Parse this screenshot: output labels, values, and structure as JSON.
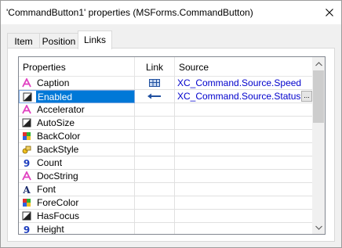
{
  "window": {
    "title": "'CommandButton1' properties (MSForms.CommandButton)"
  },
  "tabs": [
    {
      "label": "Item",
      "active": false
    },
    {
      "label": "Position",
      "active": false
    },
    {
      "label": "Links",
      "active": true
    }
  ],
  "grid": {
    "columns": {
      "properties": "Properties",
      "link": "Link",
      "source": "Source"
    },
    "rows": [
      {
        "icon": "text-property-icon",
        "label": "Caption",
        "link": "grid-link-icon",
        "source": "XC_Command.Source.Speed"
      },
      {
        "icon": "boolean-property-icon",
        "label": "Enabled",
        "link": "arrow-left-icon",
        "source": "XC_Command.Source.Status",
        "selected": true
      },
      {
        "icon": "text-property-icon",
        "label": "Accelerator",
        "link": "",
        "source": ""
      },
      {
        "icon": "boolean-property-icon",
        "label": "AutoSize",
        "link": "",
        "source": ""
      },
      {
        "icon": "color-property-icon",
        "label": "BackColor",
        "link": "",
        "source": ""
      },
      {
        "icon": "style-property-icon",
        "label": "BackStyle",
        "link": "",
        "source": ""
      },
      {
        "icon": "number-property-icon",
        "label": "Count",
        "link": "",
        "source": ""
      },
      {
        "icon": "text-property-icon",
        "label": "DocString",
        "link": "",
        "source": ""
      },
      {
        "icon": "font-property-icon",
        "label": "Font",
        "link": "",
        "source": ""
      },
      {
        "icon": "color-property-icon",
        "label": "ForeColor",
        "link": "",
        "source": ""
      },
      {
        "icon": "boolean-property-icon",
        "label": "HasFocus",
        "link": "",
        "source": ""
      },
      {
        "icon": "number-property-icon",
        "label": "Height",
        "link": "",
        "source": ""
      }
    ],
    "ellipsis": "..."
  },
  "colors": {
    "selection": "#0078d7",
    "link_text": "#0000cc",
    "text_icon": "#e040c0",
    "number_icon": "#1f3fbf"
  }
}
